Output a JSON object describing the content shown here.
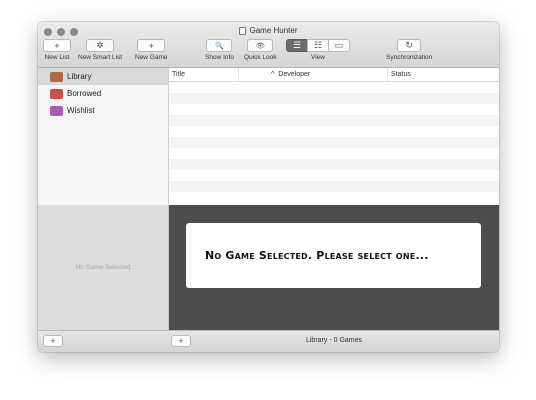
{
  "window": {
    "title": "Game Hunter"
  },
  "toolbar": {
    "new_list": {
      "label": "New List",
      "icon": "+"
    },
    "new_smart_list": {
      "label": "New Smart List",
      "icon": "✲"
    },
    "new_game": {
      "label": "New Game",
      "icon": "+"
    },
    "show_info": {
      "label": "Show Info",
      "icon": "🔍"
    },
    "quick_look": {
      "label": "Quick Look",
      "icon": "👁"
    },
    "view": {
      "label": "View",
      "icons": [
        "☰",
        "☷",
        "▭"
      ]
    },
    "sync": {
      "label": "Synchronization",
      "icon": "↻"
    }
  },
  "sidebar": {
    "items": [
      {
        "label": "Library",
        "color": "#b46a4a"
      },
      {
        "label": "Borrowed",
        "color": "#c94f48"
      },
      {
        "label": "Wishlist",
        "color": "#a95bb8"
      }
    ],
    "preview_text": "No Game Selected"
  },
  "table": {
    "columns": [
      "Title",
      "Developer",
      "Status"
    ],
    "sort_indicator": "^"
  },
  "detail": {
    "message": "No Game Selected. Please select one..."
  },
  "bottom": {
    "add_icon": "+",
    "status": "Library - 0 Games"
  }
}
